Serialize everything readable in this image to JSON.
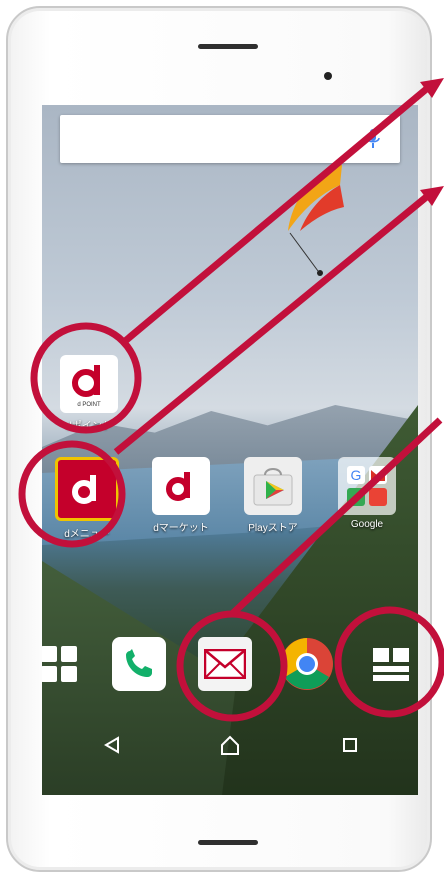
{
  "apps": [
    {
      "name": "dポイント",
      "label": "dポイント"
    },
    {
      "name": "dメニュー",
      "label": "dメニュー"
    },
    {
      "name": "dマーケット",
      "label": "dマーケット"
    },
    {
      "name": "Playストア",
      "label": "Playストア"
    },
    {
      "name": "Google",
      "label": "Google"
    }
  ],
  "dpoint_tile_text": "d POINT",
  "icons": [
    "app-drawer-icon",
    "phone-icon",
    "mail-icon",
    "chrome-icon",
    "folder-icon",
    "back-icon",
    "home-icon",
    "recents-icon",
    "mic-icon"
  ],
  "colors": {
    "docomo_red": "#c4002b",
    "annotation": "#c2103b"
  }
}
